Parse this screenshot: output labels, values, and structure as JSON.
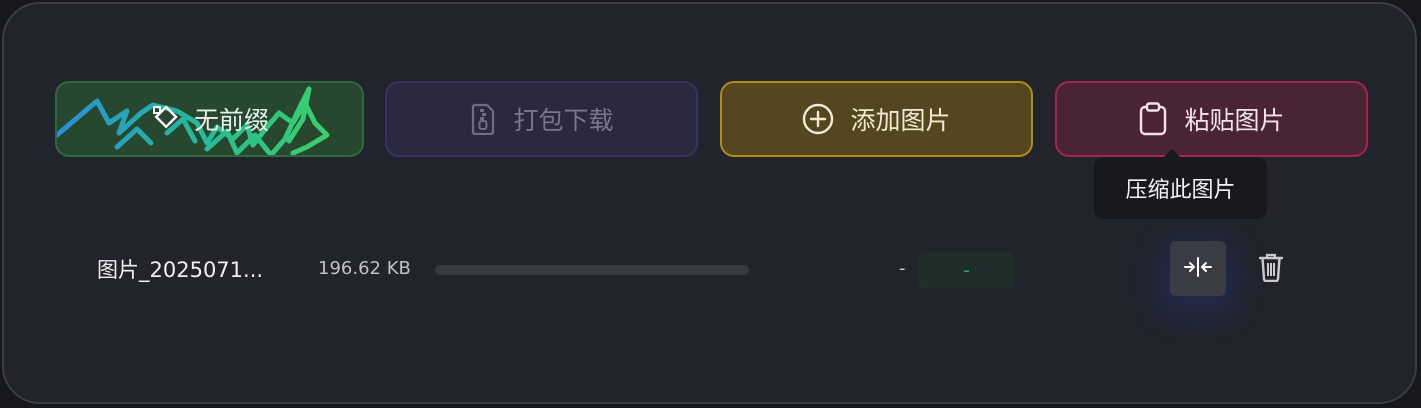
{
  "toolbar": {
    "prefix_label": "无前缀",
    "zip_label": "打包下载",
    "add_label": "添加图片",
    "paste_label": "粘贴图片"
  },
  "tooltip": {
    "compress_this": "压缩此图片"
  },
  "file_row": {
    "name": "图片_2025071...",
    "size": "196.62 KB",
    "progress": 0,
    "compressed_size": "-",
    "saving": "-"
  },
  "colors": {
    "prefix_bg": "#27472f",
    "zip_bg": "#2b2940",
    "add_bg": "#54471f",
    "add_border": "#b08c18",
    "paste_bg": "#4a2334",
    "paste_border": "#a82450",
    "saving_text": "#2fb55a"
  },
  "icons": {
    "prefix": "tag-icon",
    "zip": "zip-file-icon",
    "add": "plus-circle-icon",
    "paste": "clipboard-icon",
    "compress": "compress-arrows-icon",
    "delete": "trash-icon"
  }
}
